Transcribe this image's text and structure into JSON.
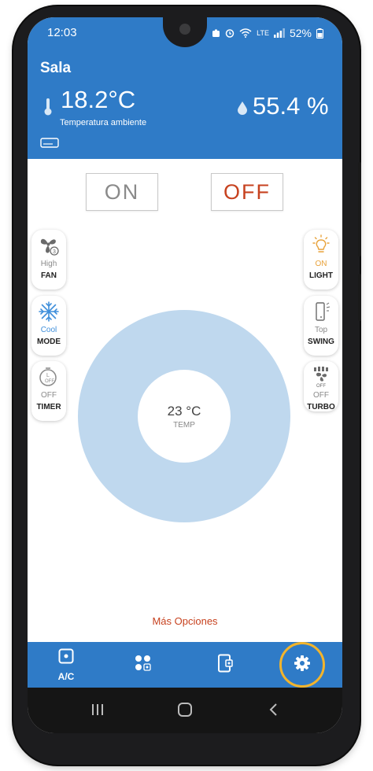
{
  "status_bar": {
    "time": "12:03",
    "battery": "52%"
  },
  "header": {
    "room": "Sala",
    "temperature": "18.2°C",
    "temperature_label": "Temperatura ambiente",
    "humidity": "55.4 %"
  },
  "power": {
    "on_label": "ON",
    "off_label": "OFF"
  },
  "left_controls": [
    {
      "value": "High",
      "label": "FAN",
      "icon": "fan-icon"
    },
    {
      "value": "Cool",
      "label": "MODE",
      "icon": "snowflake-icon"
    },
    {
      "value": "OFF",
      "label": "TIMER",
      "icon": "timer-icon"
    }
  ],
  "right_controls": [
    {
      "value": "ON",
      "label": "LIGHT",
      "icon": "lightbulb-icon"
    },
    {
      "value": "Top",
      "label": "SWING",
      "icon": "swing-icon"
    },
    {
      "value": "OFF",
      "label": "TURBO",
      "icon": "turbo-icon"
    }
  ],
  "dial": {
    "temperature": "23 °C",
    "label": "TEMP"
  },
  "more_options": "Más Opciones",
  "bottom_nav": [
    {
      "label": "A/C",
      "icon": "ac-unit-icon"
    },
    {
      "label": "",
      "icon": "scenes-icon"
    },
    {
      "label": "",
      "icon": "device-icon"
    },
    {
      "label": "",
      "icon": "settings-icon"
    }
  ],
  "colors": {
    "primary": "#2f7bc7",
    "off_red": "#c7421f",
    "dial": "#bfd8ee",
    "highlight": "#f2b42c",
    "cool_blue": "#3f8fdb",
    "light_orange": "#e8a23a"
  }
}
